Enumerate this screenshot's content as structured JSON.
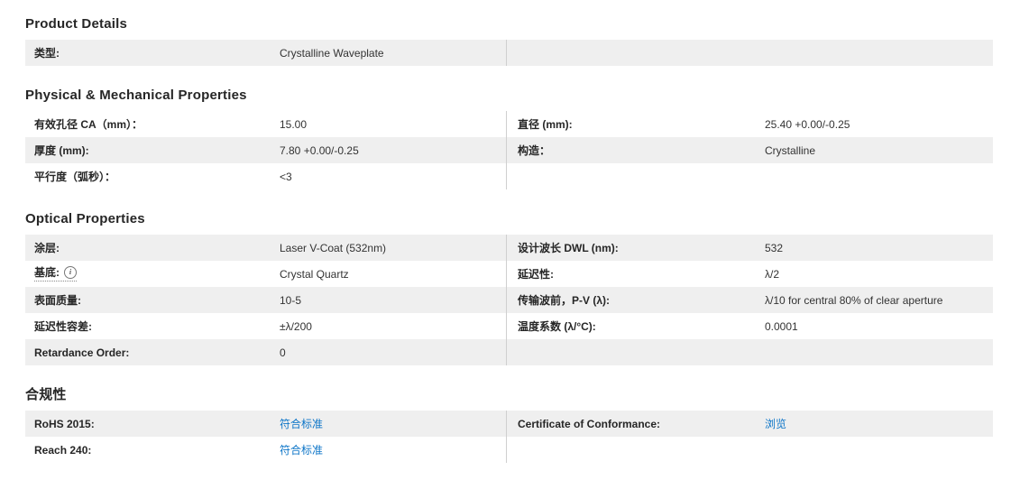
{
  "colors": {
    "link_blue": "#0e76c8",
    "row_shaded": "#efefef",
    "divider": "#cfcfcf",
    "heading_text": "#262626",
    "value_text": "#333333"
  },
  "icons": {
    "info": "i"
  },
  "sections": [
    {
      "title": "Product Details",
      "rows": [
        {
          "left": {
            "label": "类型:",
            "value": "Crystalline Waveplate"
          },
          "right": {
            "label": "",
            "value": ""
          }
        }
      ]
    },
    {
      "title": "Physical & Mechanical Properties",
      "rows": [
        {
          "left": {
            "label": "有效孔径 CA（mm）：",
            "value": "15.00"
          },
          "right": {
            "label": "直径 (mm):",
            "value": "25.40 +0.00/-0.25"
          }
        },
        {
          "left": {
            "label": "厚度 (mm):",
            "value": "7.80 +0.00/-0.25"
          },
          "right": {
            "label": "构造：",
            "value": "Crystalline"
          }
        },
        {
          "left": {
            "label": "平行度（弧秒）：",
            "value": "<3"
          },
          "right": {
            "label": "",
            "value": ""
          }
        }
      ]
    },
    {
      "title": "Optical Properties",
      "rows": [
        {
          "left": {
            "label": "涂层:",
            "value": "Laser V-Coat (532nm)"
          },
          "right": {
            "label": "设计波长 DWL (nm):",
            "value": "532"
          }
        },
        {
          "left": {
            "label": "基底:",
            "value": "Crystal Quartz"
          },
          "right": {
            "label": "延迟性:",
            "value": "λ/2"
          }
        },
        {
          "left": {
            "label": "表面质量:",
            "value": "10-5"
          },
          "right": {
            "label": "传输波前，P-V (λ):",
            "value": "λ/10 for central 80% of clear aperture"
          }
        },
        {
          "left": {
            "label": "延迟性容差:",
            "value": "±λ/200"
          },
          "right": {
            "label": "温度系数 (λ/°C):",
            "value": "0.0001"
          }
        },
        {
          "left": {
            "label": "Retardance Order:",
            "value": "0"
          },
          "right": {
            "label": "",
            "value": ""
          }
        }
      ]
    },
    {
      "title": "合规性",
      "rows": [
        {
          "left": {
            "label": "RoHS 2015:",
            "value": "符合标准"
          },
          "right": {
            "label": "Certificate of Conformance:",
            "value": "浏览"
          }
        },
        {
          "left": {
            "label": "Reach 240:",
            "value": "符合标准"
          },
          "right": {
            "label": "",
            "value": ""
          }
        }
      ]
    }
  ]
}
